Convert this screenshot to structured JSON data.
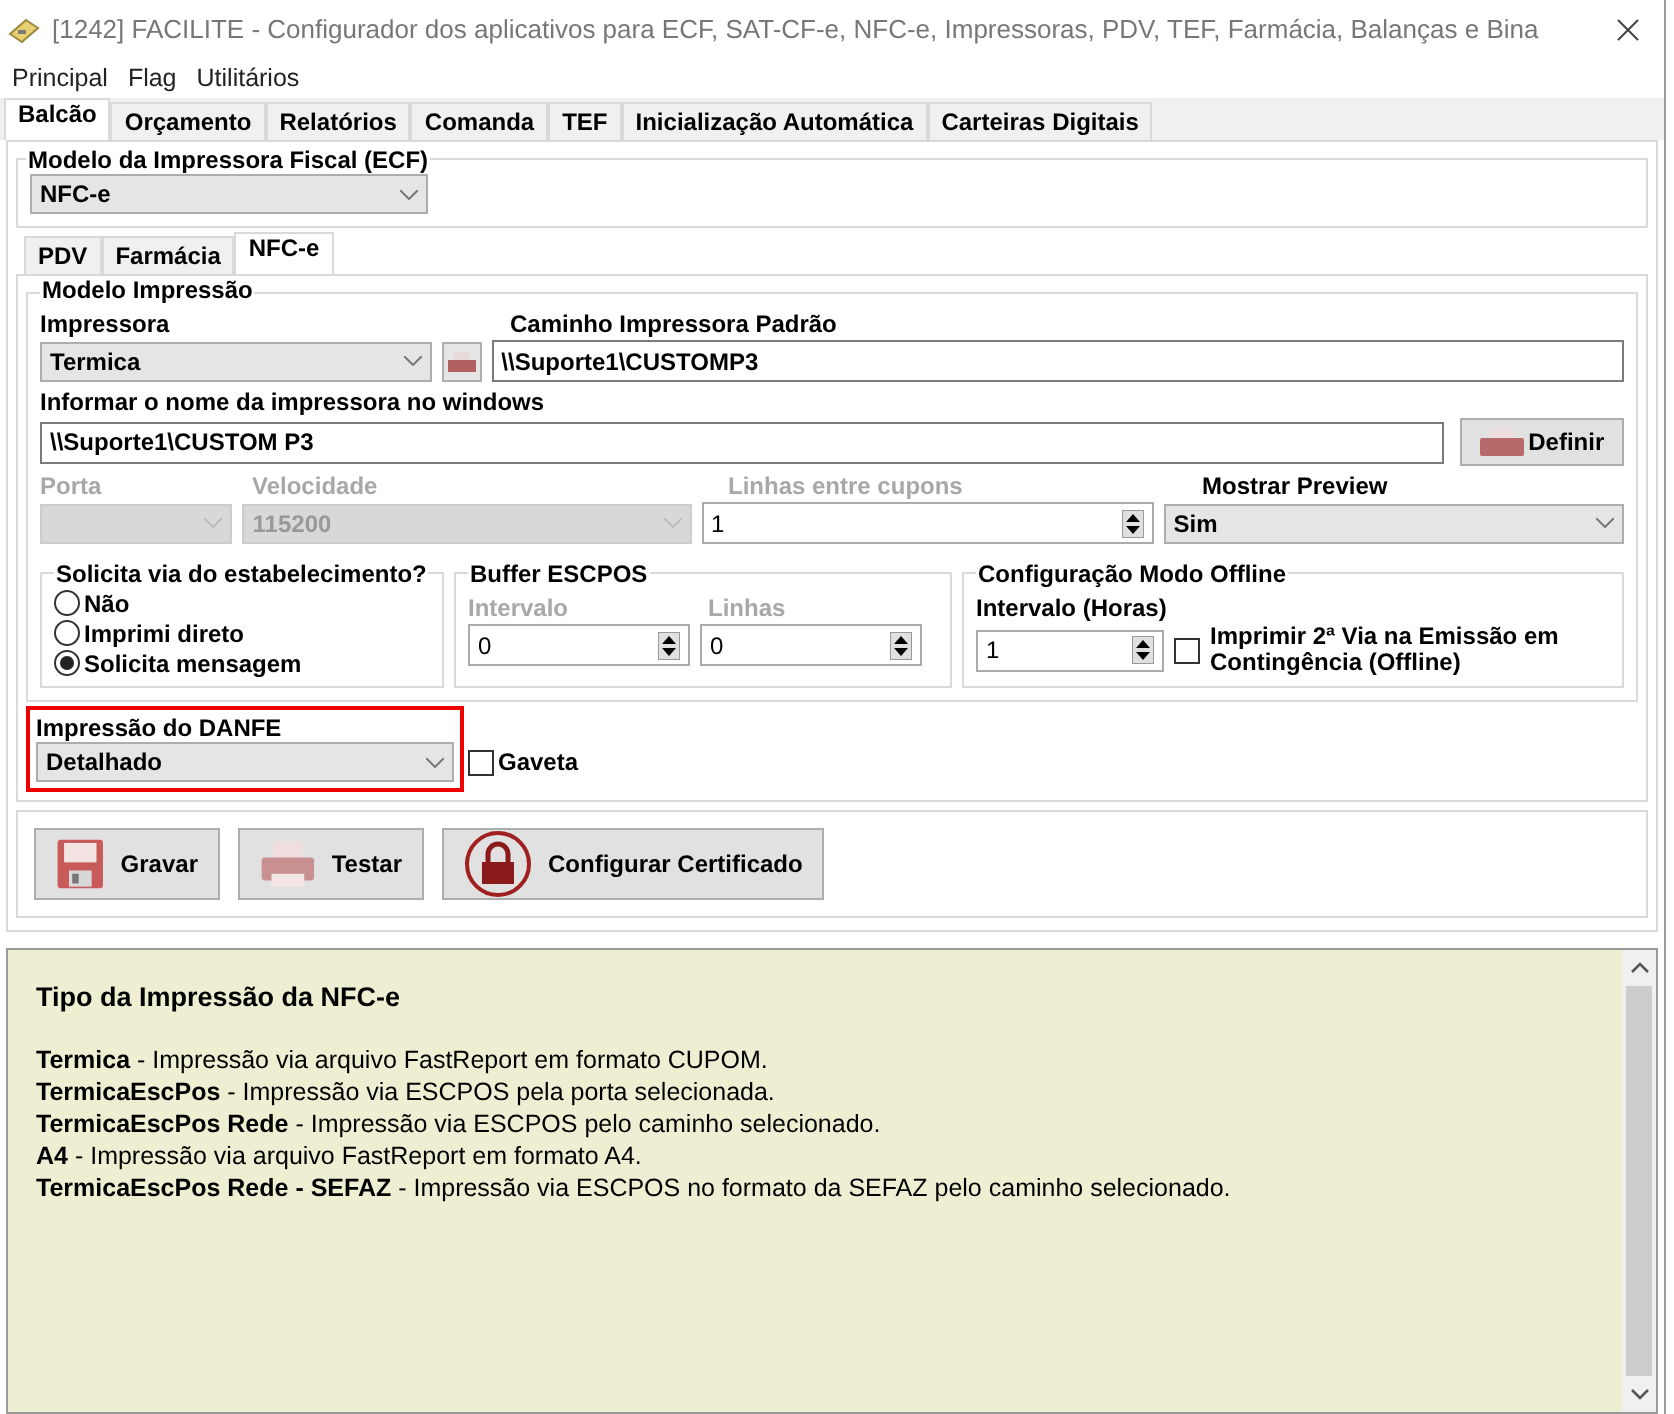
{
  "window": {
    "title": "[1242] FACILITE - Configurador dos aplicativos para ECF, SAT-CF-e, NFC-e, Impressoras, PDV, TEF, Farmácia, Balanças e Bina"
  },
  "menu": [
    "Principal",
    "Flag",
    "Utilitários"
  ],
  "tabs": [
    {
      "label": "Balcão",
      "selected": true
    },
    {
      "label": "Orçamento",
      "selected": false
    },
    {
      "label": "Relatórios",
      "selected": false
    },
    {
      "label": "Comanda",
      "selected": false
    },
    {
      "label": "TEF",
      "selected": false
    },
    {
      "label": "Inicialização Automática",
      "selected": false
    },
    {
      "label": "Carteiras Digitais",
      "selected": false
    }
  ],
  "ecf": {
    "title": "Modelo da Impressora Fiscal (ECF)",
    "value": "NFC-e"
  },
  "sub_tabs": [
    {
      "label": "PDV",
      "selected": false
    },
    {
      "label": "Farmácia",
      "selected": false
    },
    {
      "label": "NFC-e",
      "selected": true
    }
  ],
  "modelo": {
    "title": "Modelo Impressão",
    "impressora": {
      "label": "Impressora",
      "value": "Termica"
    },
    "caminho": {
      "label": "Caminho Impressora Padrão",
      "value": "\\\\Suporte1\\CUSTOMP3"
    },
    "nome": {
      "label": "Informar o nome da impressora no windows",
      "value": "\\\\Suporte1\\CUSTOM P3"
    },
    "definir": "Definir",
    "porta": {
      "label": "Porta",
      "disabled": true
    },
    "velocidade": {
      "label": "Velocidade",
      "value": "115200",
      "disabled": true
    },
    "linhas": {
      "label": "Linhas entre cupons",
      "value": "1",
      "disabled": true
    },
    "preview": {
      "label": "Mostrar Preview",
      "value": "Sim"
    },
    "via": {
      "title": "Solicita via do estabelecimento?",
      "options": [
        {
          "label": "Não",
          "selected": false
        },
        {
          "label": "Imprimi direto",
          "selected": false
        },
        {
          "label": "Solicita mensagem",
          "selected": true
        }
      ]
    },
    "buffer": {
      "title": "Buffer ESCPOS",
      "fields": [
        {
          "label": "Intervalo",
          "value": "0",
          "disabled": true
        },
        {
          "label": "Linhas",
          "value": "0",
          "disabled": true
        }
      ]
    },
    "offline": {
      "title": "Configuração Modo Offline",
      "interval": {
        "label": "Intervalo (Horas)",
        "value": "1"
      },
      "option": {
        "label": "Imprimir 2ª Via na Emissão em Contingência (Offline)",
        "checked": false
      }
    }
  },
  "danfe": {
    "label": "Impressão do DANFE",
    "value": "Detalhado",
    "highlighted": true
  },
  "gaveta": {
    "label": "Gaveta",
    "checked": false
  },
  "buttons": [
    {
      "label": "Gravar",
      "kind": "save"
    },
    {
      "label": "Testar",
      "kind": "print"
    },
    {
      "label": "Configurar Certificado",
      "kind": "lock"
    }
  ],
  "help": {
    "title": "Tipo da Impressão da NFC-e",
    "lines": [
      "**Termica** - Impressão via arquivo FastReport em formato CUPOM.",
      "**TermicaEscPos** - Impressão via ESCPOS pela porta selecionada.",
      "**TermicaEscPos Rede** - Impressão via ESCPOS pelo caminho selecionado.",
      "**A4** - Impressão via arquivo FastReport em formato A4.",
      "**TermicaEscPos Rede - SEFAZ** - Impressão via ESCPOS no formato da SEFAZ pelo caminho selecionado."
    ]
  }
}
